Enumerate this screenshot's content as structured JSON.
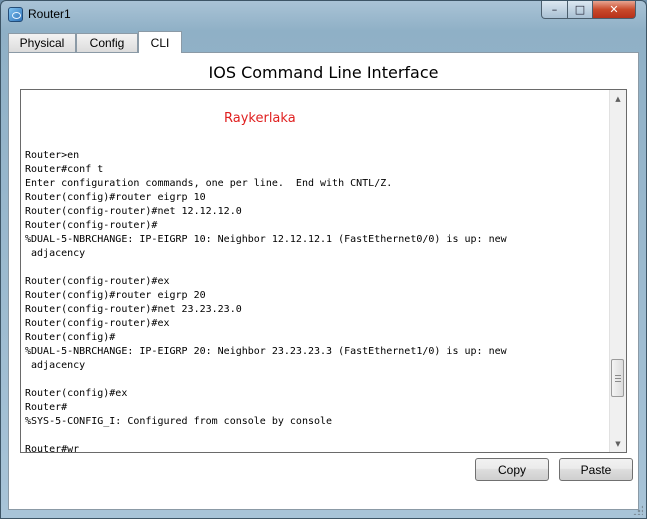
{
  "window": {
    "title": "Router1",
    "minimize_glyph": "–",
    "maximize_glyph": "□",
    "close_glyph": "✕",
    "icon": "router-app-icon"
  },
  "tabs": [
    {
      "label": "Physical",
      "active": false
    },
    {
      "label": "Config",
      "active": false
    },
    {
      "label": "CLI",
      "active": true
    }
  ],
  "panel": {
    "title": "IOS Command Line Interface"
  },
  "terminal": {
    "watermark": "Raykerlaka",
    "lines": [
      "Router>en",
      "Router#conf t",
      "Enter configuration commands, one per line.  End with CNTL/Z.",
      "Router(config)#router eigrp 10",
      "Router(config-router)#net 12.12.12.0",
      "Router(config-router)#",
      "%DUAL-5-NBRCHANGE: IP-EIGRP 10: Neighbor 12.12.12.1 (FastEthernet0/0) is up: new",
      " adjacency",
      "",
      "Router(config-router)#ex",
      "Router(config)#router eigrp 20",
      "Router(config-router)#net 23.23.23.0",
      "Router(config-router)#ex",
      "Router(config)#",
      "%DUAL-5-NBRCHANGE: IP-EIGRP 20: Neighbor 23.23.23.3 (FastEthernet1/0) is up: new",
      " adjacency",
      "",
      "Router(config)#ex",
      "Router#",
      "%SYS-5-CONFIG_I: Configured from console by console",
      "",
      "Router#wr"
    ],
    "scroll_position_fraction": 0.87
  },
  "buttons": {
    "copy": "Copy",
    "paste": "Paste"
  },
  "colors": {
    "watermark": "#e02020",
    "window_frame": "#a9c3d6",
    "close_button": "#c94a2b"
  }
}
